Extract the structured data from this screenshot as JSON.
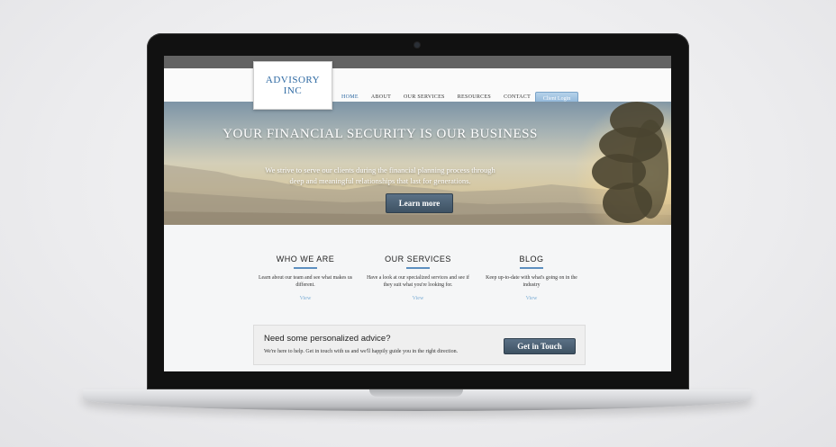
{
  "site": {
    "logo_line1": "ADVISORY",
    "logo_line2": "INC",
    "nav": [
      "HOME",
      "ABOUT",
      "OUR SERVICES",
      "RESOURCES",
      "CONTACT"
    ],
    "login_label": "Client Login"
  },
  "hero": {
    "title": "YOUR FINANCIAL SECURITY IS OUR BUSINESS",
    "subtitle": "We strive to serve our clients during the financial planning process through deep and meaningful relationships that last for generations.",
    "button": "Learn more"
  },
  "columns": [
    {
      "title": "WHO WE ARE",
      "text": "Learn about our team and see what makes us different.",
      "link": "View"
    },
    {
      "title": "OUR SERVICES",
      "text": "Have a look at our specialized services and see if they suit what you're looking for.",
      "link": "View"
    },
    {
      "title": "BLOG",
      "text": "Keep up-to-date with what's going on in the industry",
      "link": "View"
    }
  ],
  "cta": {
    "title": "Need some personalized advice?",
    "text": "We're here to help. Get in touch with us and we'll happily guide you in the right direction.",
    "button": "Get in Touch"
  },
  "colors": {
    "accent": "#2f6aa3",
    "button": "#4a5e70",
    "link": "#7eaed6"
  }
}
